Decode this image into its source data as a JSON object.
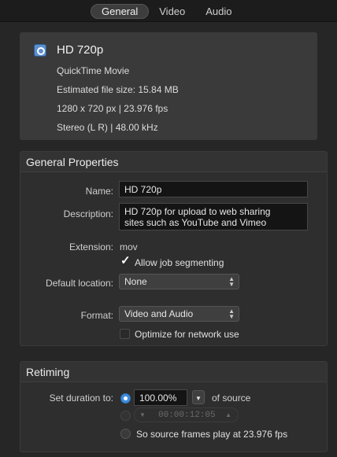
{
  "tabs": [
    "General",
    "Video",
    "Audio"
  ],
  "summary": {
    "icon": "quicktime-icon",
    "title": "HD 720p",
    "format": "QuickTime Movie",
    "file_size": "Estimated file size: 15.84 MB",
    "video": "1280 x 720 px | 23.976 fps",
    "audio": "Stereo (L R) | 48.00 kHz"
  },
  "general": {
    "header": "General Properties",
    "name_label": "Name:",
    "name_value": "HD 720p",
    "description_label": "Description:",
    "description_line1": "HD 720p for upload to web sharing",
    "description_line2": "sites such as YouTube and Vimeo",
    "extension_label": "Extension:",
    "extension_value": "mov",
    "allow_segmenting_label": "Allow job segmenting",
    "allow_segmenting_checked": true,
    "default_location_label": "Default location:",
    "default_location_value": "None",
    "format_label": "Format:",
    "format_value": "Video and Audio",
    "optimize_label": "Optimize for network use",
    "optimize_checked": false
  },
  "retiming": {
    "header": "Retiming",
    "set_duration_label": "Set duration to:",
    "percent_value": "100.00%",
    "of_source": "of source",
    "timecode": "00:00:12:05",
    "frames_option": "So source frames play at 23.976 fps"
  },
  "colors": {
    "accent": "#3d8ee0",
    "background": "#262626"
  }
}
